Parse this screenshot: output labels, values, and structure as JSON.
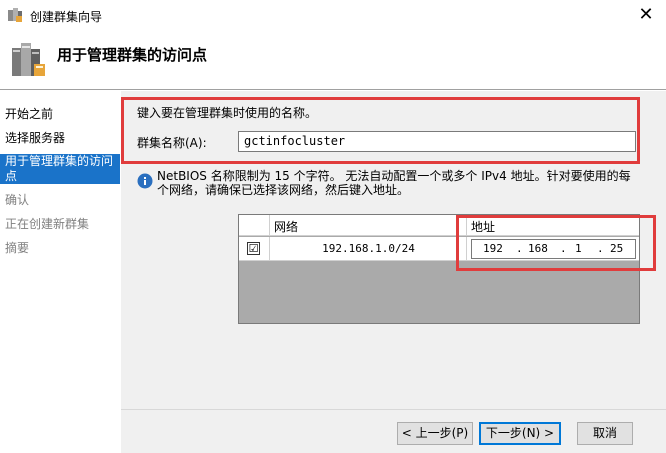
{
  "window": {
    "title": "创建群集向导",
    "close_glyph": "✕"
  },
  "header": {
    "heading": "用于管理群集的访问点"
  },
  "sidebar": {
    "items": [
      {
        "label": "开始之前"
      },
      {
        "label": "选择服务器"
      },
      {
        "label": "用于管理群集的访问点"
      },
      {
        "label": "确认"
      },
      {
        "label": "正在创建新群集"
      },
      {
        "label": "摘要"
      }
    ]
  },
  "form": {
    "instruction": "键入要在管理群集时使用的名称。",
    "name_label": "群集名称(A):",
    "name_value": "gctinfocluster",
    "info_text": "NetBIOS 名称限制为 15 个字符。 无法自动配置一个或多个 IPv4 地址。针对要使用的每个网络，请确保已选择该网络，然后键入地址。"
  },
  "grid": {
    "columns": {
      "network": "网络",
      "address": "地址"
    },
    "rows": [
      {
        "checked": "☑",
        "network": "192.168.1.0/24",
        "address": [
          "192",
          "168",
          "1",
          "25"
        ]
      }
    ]
  },
  "buttons": {
    "back": "< 上一步(P)",
    "next": "下一步(N) >",
    "cancel": "取消"
  },
  "colors": {
    "accent": "#1a73c9",
    "highlight_box": "#e03c3c"
  }
}
